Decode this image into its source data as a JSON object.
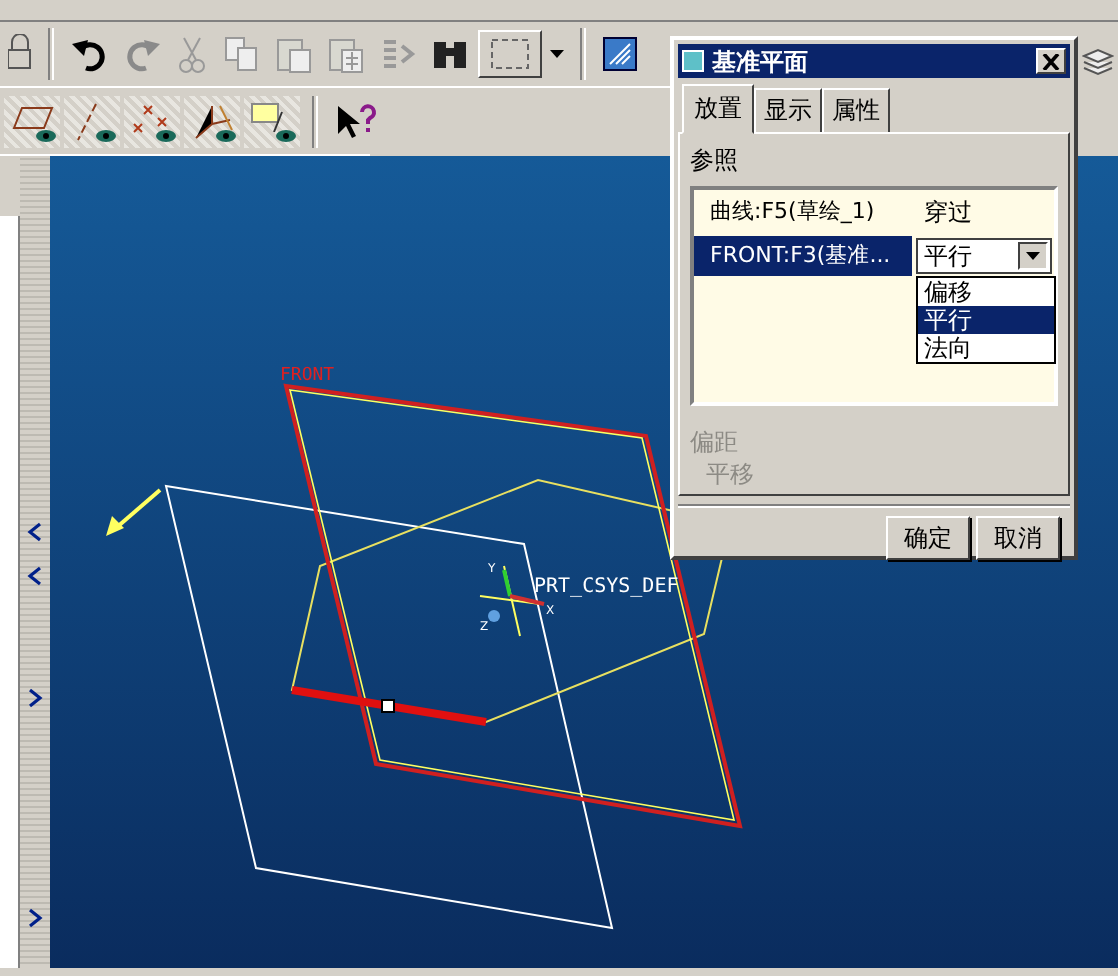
{
  "dialog": {
    "title": "基准平面",
    "tabs": [
      {
        "label": "放置",
        "selected": true
      },
      {
        "label": "显示",
        "selected": false
      },
      {
        "label": "属性",
        "selected": false
      }
    ],
    "section_label": "参照",
    "references": [
      {
        "kind": "text",
        "name": "曲线:F5(草绘_1)",
        "constraint": "穿过",
        "selected": false
      },
      {
        "kind": "dropdown",
        "name": "FRONT:F3(基准...",
        "constraint": "平行",
        "selected": true,
        "expanded": true,
        "options": [
          {
            "label": "偏移",
            "selected": false
          },
          {
            "label": "平行",
            "selected": true
          },
          {
            "label": "法向",
            "selected": false
          }
        ]
      }
    ],
    "offset": {
      "label": "偏距",
      "value": "平移",
      "disabled": true
    },
    "buttons": [
      "确定",
      "取消"
    ]
  },
  "viewport": {
    "plane_label": "FRONT",
    "csys_label": "PRT_CSYS_DEF",
    "axis_labels": [
      "Y",
      "X",
      "Z"
    ]
  }
}
